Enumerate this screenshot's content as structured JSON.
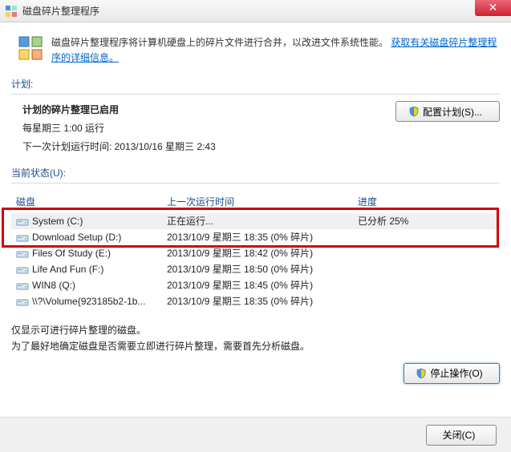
{
  "window": {
    "title": "磁盘碎片整理程序"
  },
  "info": {
    "text": "磁盘碎片整理程序将计算机硬盘上的碎片文件进行合并，以改进文件系统性能。",
    "link": "获取有关磁盘碎片整理程序的详细信息。"
  },
  "schedule": {
    "label": "计划:",
    "title": "计划的碎片整理已启用",
    "line1": "每星期三  1:00 运行",
    "line2": "下一次计划运行时间: 2013/10/16 星期三 2:43",
    "configure_btn": "配置计划(S)..."
  },
  "status": {
    "label": "当前状态(U):",
    "headers": {
      "disk": "磁盘",
      "last_run": "上一次运行时间",
      "progress": "进度"
    },
    "rows": [
      {
        "name": "System (C:)",
        "last_run": "正在运行...",
        "progress": "已分析 25%",
        "selected": true
      },
      {
        "name": "Download Setup (D:)",
        "last_run": "2013/10/9 星期三 18:35 (0% 碎片)",
        "progress": ""
      },
      {
        "name": "Files Of Study (E:)",
        "last_run": "2013/10/9 星期三 18:42 (0% 碎片)",
        "progress": ""
      },
      {
        "name": "Life And Fun (F:)",
        "last_run": "2013/10/9 星期三 18:50 (0% 碎片)",
        "progress": ""
      },
      {
        "name": "WIN8 (Q:)",
        "last_run": "2013/10/9 星期三 18:45 (0% 碎片)",
        "progress": ""
      },
      {
        "name": "\\\\?\\Volume{923185b2-1b...",
        "last_run": "2013/10/9 星期三 18:35 (0% 碎片)",
        "progress": ""
      }
    ]
  },
  "hint": {
    "line1": "仅显示可进行碎片整理的磁盘。",
    "line2": "为了最好地确定磁盘是否需要立即进行碎片整理，需要首先分析磁盘。"
  },
  "actions": {
    "stop": "停止操作(O)",
    "close": "关闭(C)"
  }
}
